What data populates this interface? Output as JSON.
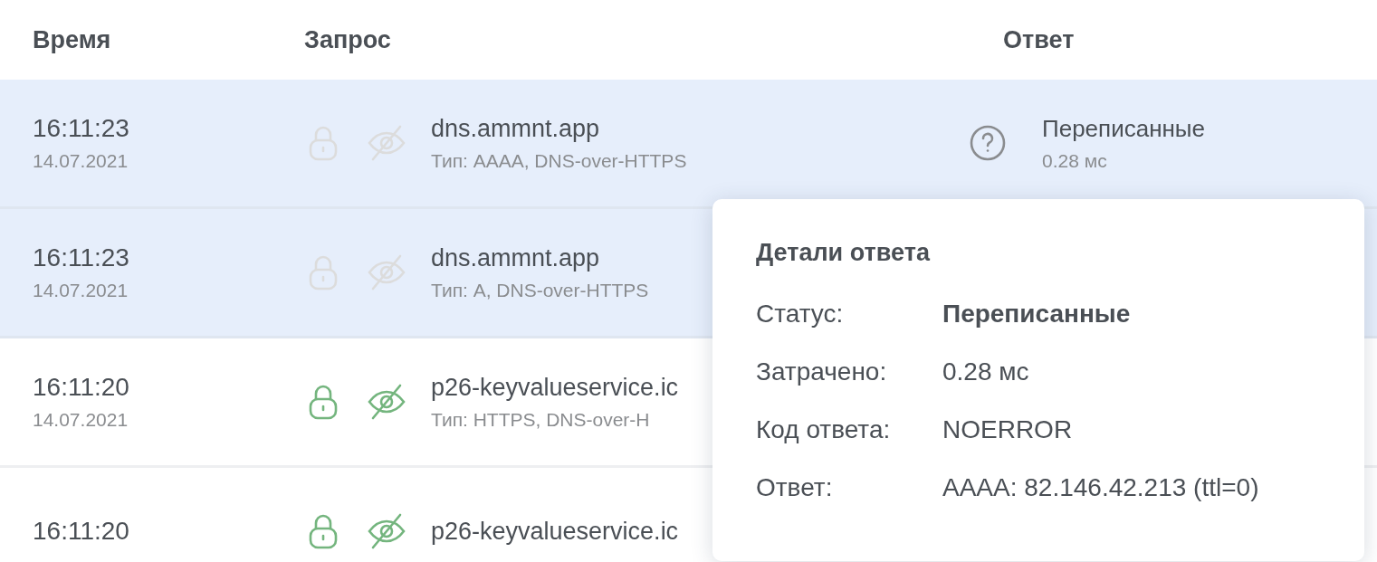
{
  "table": {
    "columns": [
      "Время",
      "Запрос",
      "Ответ"
    ],
    "rows": [
      {
        "time": "16:11:23",
        "date": "14.07.2021",
        "domain": "dns.ammnt.app",
        "detail": "Тип: AAAA, DNS-over-HTTPS",
        "highlighted": true,
        "protected": false,
        "response": {
          "status": "Переписанные",
          "elapsed": "0.28 мс"
        }
      },
      {
        "time": "16:11:23",
        "date": "14.07.2021",
        "domain": "dns.ammnt.app",
        "detail": "Тип: A, DNS-over-HTTPS",
        "highlighted": true,
        "protected": false
      },
      {
        "time": "16:11:20",
        "date": "14.07.2021",
        "domain": "p26-keyvalueservice.ic",
        "detail": "Тип: HTTPS, DNS-over-H",
        "highlighted": false,
        "protected": true
      },
      {
        "time": "16:11:20",
        "domain": "p26-keyvalueservice.ic",
        "highlighted": false,
        "protected": true
      }
    ]
  },
  "popover": {
    "title": "Детали ответа",
    "fields": [
      {
        "label": "Статус:",
        "value": "Переписанные",
        "kind": "strong"
      },
      {
        "label": "Затрачено:",
        "value": "0.28 мс",
        "kind": "plain"
      },
      {
        "label": "Код ответа:",
        "value": "NOERROR",
        "kind": "plain"
      },
      {
        "label": "Ответ:",
        "value": "AAAA: 82.146.42.213 (ttl=0)",
        "kind": "plain"
      }
    ]
  }
}
